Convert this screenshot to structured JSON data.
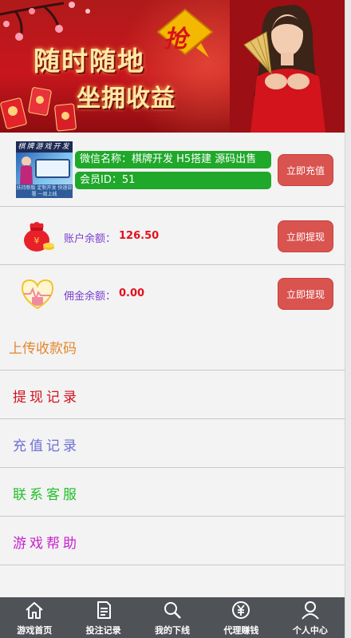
{
  "banner": {
    "line1": "随时随地",
    "line2": "坐拥收益",
    "badge": "抢"
  },
  "member": {
    "thumb": {
      "title": "棋牌游戏开发",
      "caption": "扶持新版 定制开发 快速部署 一周上线"
    },
    "wechat_text": "微信名称：棋牌开发 H5搭建 源码出售",
    "member_id_text": "会员ID：51",
    "recharge_button": "立即充值"
  },
  "account_balance": {
    "label": "账户余额：",
    "value": "126.50",
    "button": "立即提现"
  },
  "commission_balance": {
    "label": "佣金余额：",
    "value": "0.00",
    "button": "立即提现"
  },
  "menu": [
    {
      "label": "上传收款码",
      "color": "#e3872e"
    },
    {
      "label": "提现记录",
      "color": "#d0121c"
    },
    {
      "label": "充值记录",
      "color": "#6e6ed6"
    },
    {
      "label": "联系客服",
      "color": "#22c02a"
    },
    {
      "label": "游戏帮助",
      "color": "#c91fcf"
    }
  ],
  "nav": [
    {
      "label": "游戏首页",
      "icon": "home-icon"
    },
    {
      "label": "投注记录",
      "icon": "document-icon"
    },
    {
      "label": "我的下线",
      "icon": "search-icon"
    },
    {
      "label": "代理赚钱",
      "icon": "yuan-icon"
    },
    {
      "label": "个人中心",
      "icon": "user-icon"
    }
  ],
  "colors": {
    "button_red": "#d9534f",
    "pill_green": "#1fa82a",
    "nav_bg": "#4f5358",
    "value_red": "#e2121d",
    "label_purple": "#7b3fcf"
  }
}
